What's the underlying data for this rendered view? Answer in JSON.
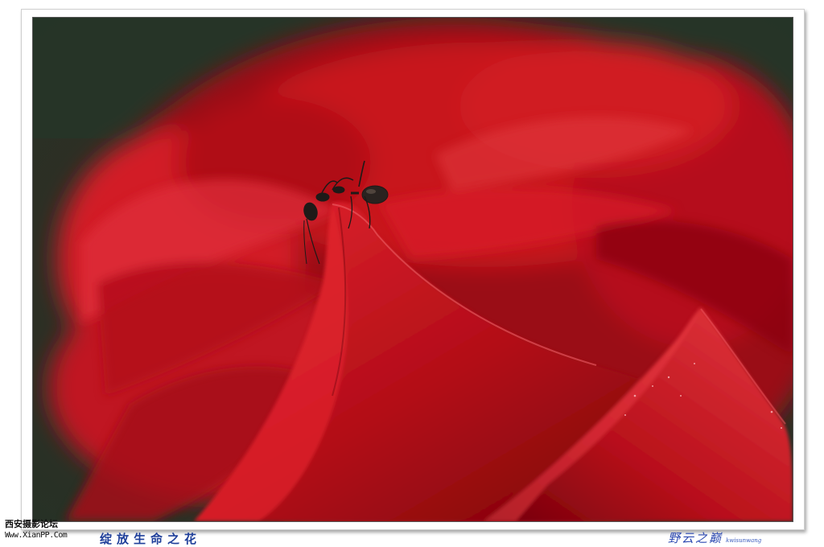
{
  "watermark": {
    "site_name": "西安摄影论坛",
    "site_url": "Www.XianPP.Com"
  },
  "caption": "绽放生命之花",
  "signature": {
    "name": "野云之巅",
    "tag": "kwisunwang"
  },
  "photo": {
    "subject": "ant-on-red-rose-petal",
    "colors": {
      "background": "#2c3b2d",
      "petal_dark": "#7a0008",
      "petal_mid": "#c0101c",
      "petal_light": "#e8303a",
      "ant": "#1e1a18"
    }
  }
}
